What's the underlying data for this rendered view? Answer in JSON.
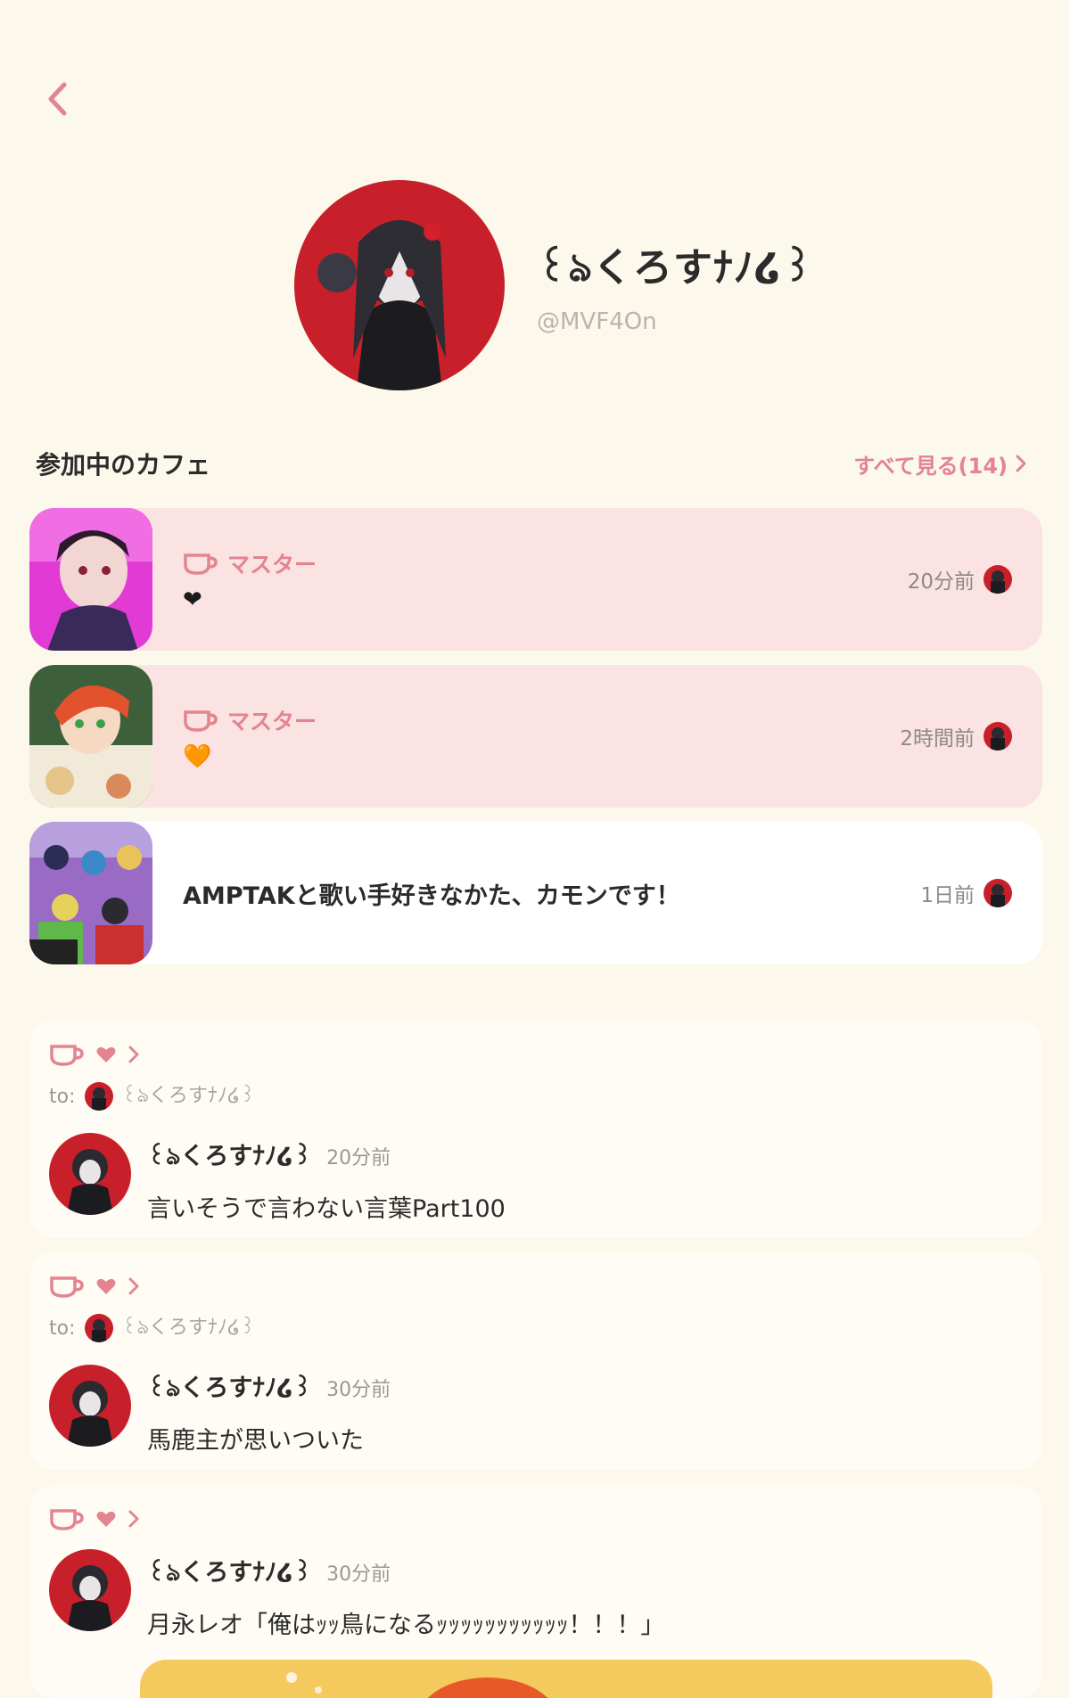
{
  "profile": {
    "name": "꒰ঌくろすﾅﾉ໒꒱",
    "handle": "@MVF4On"
  },
  "cafes_section": {
    "title": "参加中のカフェ",
    "see_all": "すべて見る(14)"
  },
  "cafes": [
    {
      "role": "マスター",
      "content": "❤",
      "time": "20分前",
      "highlighted": true
    },
    {
      "role": "マスター",
      "content": "🧡",
      "time": "2時間前",
      "highlighted": true
    },
    {
      "name": "AMPTAKと歌い手好きなかた、カモンです！",
      "time": "1日前",
      "highlighted": false
    }
  ],
  "posts": [
    {
      "to_label": "to:",
      "to_name": "꒰ঌくろすﾅﾉ໒꒱",
      "author": "꒰ঌくろすﾅﾉ໒꒱",
      "time": "20分前",
      "body": "言いそうで言わない言葉Part100"
    },
    {
      "to_label": "to:",
      "to_name": "꒰ঌくろすﾅﾉ໒꒱",
      "author": "꒰ঌくろすﾅﾉ໒꒱",
      "time": "30分前",
      "body": "馬鹿主が思いついた"
    },
    {
      "author": "꒰ঌくろすﾅﾉ໒꒱",
      "time": "30分前",
      "body": "月永レオ「俺はｯｯ鳥になるｯｯｯｯｯｯｯｯｯｯｯ！！！」"
    }
  ],
  "colors": {
    "background": "#fdf8ec",
    "accent": "#e3848f",
    "highlight_card": "#fbe2e3"
  },
  "icons": [
    "back-chevron-icon",
    "chevron-right-icon",
    "cup-icon",
    "heart-icon"
  ]
}
